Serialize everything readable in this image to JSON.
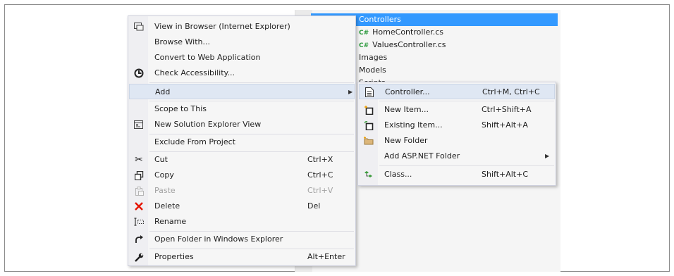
{
  "solution_explorer": {
    "rows": [
      {
        "text": "Controllers",
        "selected": true
      },
      {
        "text": "HomeController.cs",
        "badge": "C#"
      },
      {
        "text": "ValuesController.cs",
        "badge": "C#"
      },
      {
        "text": "Images"
      },
      {
        "text": "Models"
      },
      {
        "text": "Scripts"
      }
    ]
  },
  "context_menu": {
    "view_in_browser": "View in Browser (Internet Explorer)",
    "browse_with": "Browse With...",
    "convert": "Convert to Web Application",
    "check_accessibility": "Check Accessibility...",
    "add": "Add",
    "scope_to_this": "Scope to This",
    "new_solution_explorer_view": "New Solution Explorer View",
    "exclude_from_project": "Exclude From Project",
    "cut": "Cut",
    "cut_shortcut": "Ctrl+X",
    "copy": "Copy",
    "copy_shortcut": "Ctrl+C",
    "paste": "Paste",
    "paste_shortcut": "Ctrl+V",
    "delete": "Delete",
    "delete_shortcut": "Del",
    "rename": "Rename",
    "open_folder": "Open Folder in Windows Explorer",
    "properties": "Properties",
    "properties_shortcut": "Alt+Enter"
  },
  "add_submenu": {
    "controller": "Controller...",
    "controller_shortcut": "Ctrl+M, Ctrl+C",
    "new_item": "New Item...",
    "new_item_shortcut": "Ctrl+Shift+A",
    "existing_item": "Existing Item...",
    "existing_item_shortcut": "Shift+Alt+A",
    "new_folder": "New Folder",
    "add_aspnet_folder": "Add ASP.NET Folder",
    "class": "Class...",
    "class_shortcut": "Shift+Alt+C"
  },
  "colors": {
    "selection": "#3399ff",
    "menu_bg": "#f6f6f6",
    "highlight": "#dfe7f3",
    "delete_red": "#e51400",
    "cs_green": "#2e9b3f"
  }
}
